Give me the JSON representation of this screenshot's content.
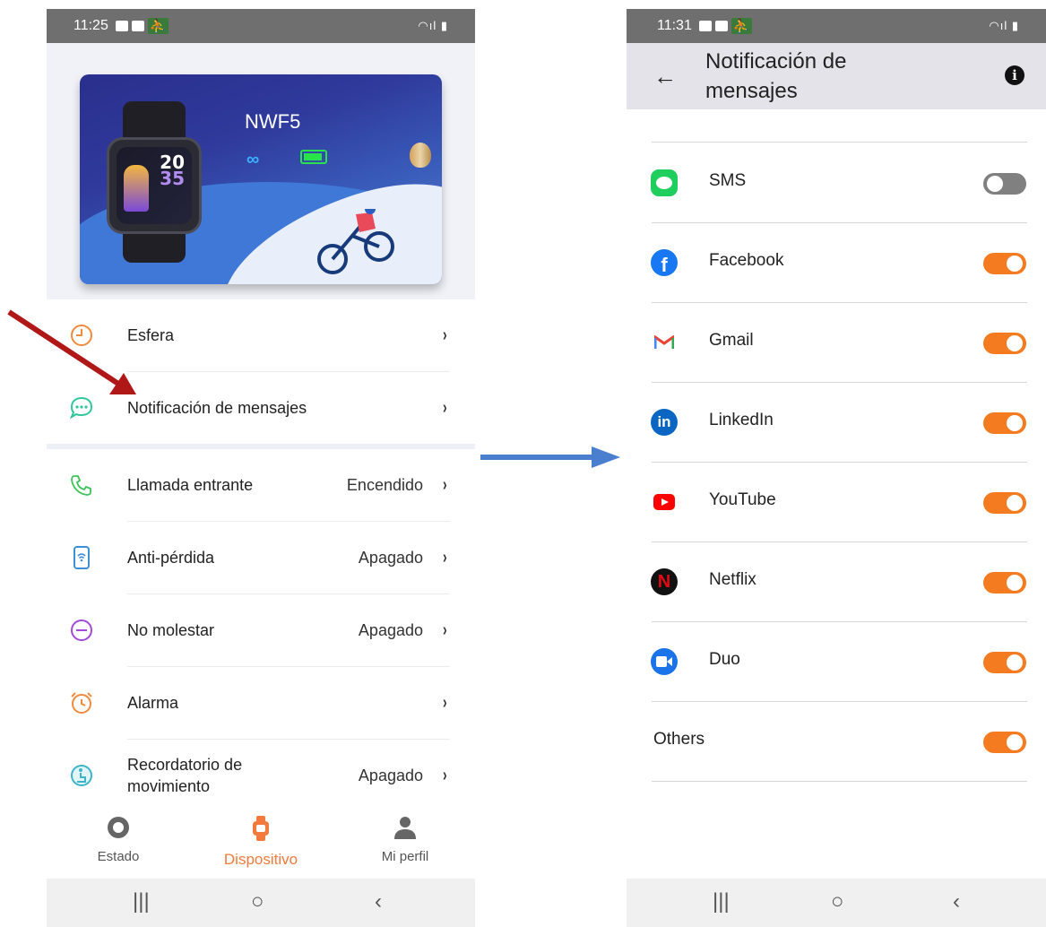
{
  "left_phone": {
    "status": {
      "time": "11:25"
    },
    "device_card": {
      "model": "NWF5",
      "watch_hours": "20",
      "watch_minutes": "35"
    },
    "menu": [
      {
        "label": "Esfera",
        "value": "",
        "icon": "watch-face-icon"
      },
      {
        "label": "Notificación de mensajes",
        "value": "",
        "icon": "chat-bubble-icon"
      },
      {
        "label": "Llamada entrante",
        "value": "Encendido",
        "icon": "phone-icon"
      },
      {
        "label": "Anti-pérdida",
        "value": "Apagado",
        "icon": "watch-signal-icon"
      },
      {
        "label": "No molestar",
        "value": "Apagado",
        "icon": "minus-circle-icon"
      },
      {
        "label": "Alarma",
        "value": "",
        "icon": "alarm-clock-icon"
      },
      {
        "label": "Recordatorio de movimiento",
        "value": "Apagado",
        "icon": "sit-reminder-icon"
      }
    ],
    "bottom_nav": [
      {
        "label": "Estado",
        "icon": "status-circle-icon",
        "active": false
      },
      {
        "label": "Dispositivo",
        "icon": "watch-icon",
        "active": true
      },
      {
        "label": "Mi perfil",
        "icon": "person-icon",
        "active": false
      }
    ],
    "chevron": "›"
  },
  "right_phone": {
    "status": {
      "time": "11:31"
    },
    "title": "Notificación de mensajes",
    "apps": [
      {
        "name": "SMS",
        "icon": "sms-icon",
        "on": false
      },
      {
        "name": "Facebook",
        "icon": "facebook-icon",
        "on": true
      },
      {
        "name": "Gmail",
        "icon": "gmail-icon",
        "on": true
      },
      {
        "name": "LinkedIn",
        "icon": "linkedin-icon",
        "on": true
      },
      {
        "name": "YouTube",
        "icon": "youtube-icon",
        "on": true
      },
      {
        "name": "Netflix",
        "icon": "netflix-icon",
        "on": true
      },
      {
        "name": "Duo",
        "icon": "duo-icon",
        "on": true
      },
      {
        "name": "Others",
        "icon": "",
        "on": true
      }
    ]
  },
  "colors": {
    "accent": "#f47b20",
    "toggle_off": "#808080",
    "red_arrow": "#b01818",
    "blue_arrow": "#4a7fcf"
  }
}
